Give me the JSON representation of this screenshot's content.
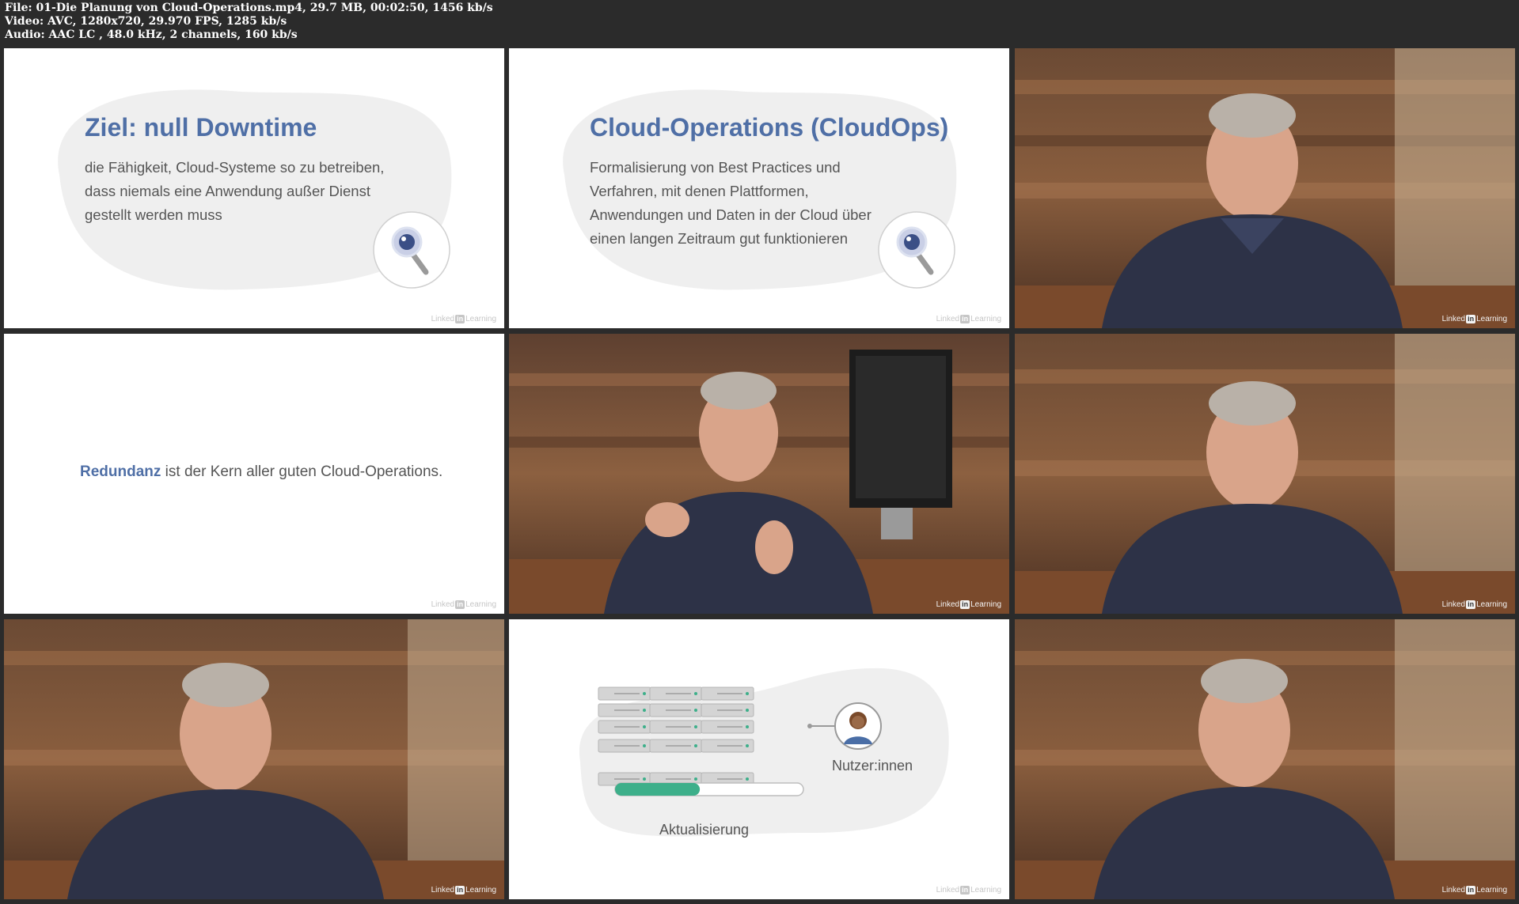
{
  "file_info": {
    "line1": "File: 01-Die Planung von Cloud-Operations.mp4, 29.7 MB, 00:02:50, 1456 kb/s",
    "line2": "Video: AVC, 1280x720, 29.970 FPS, 1285 kb/s",
    "line3": "Audio: AAC LC , 48.0 kHz, 2 channels, 160 kb/s"
  },
  "slides": {
    "goal": {
      "title": "Ziel: null Downtime",
      "body": "die Fähigkeit, Cloud-Systeme so zu betreiben, dass niemals eine Anwendung außer Dienst gestellt werden muss"
    },
    "cloudops": {
      "title": "Cloud-Operations (CloudOps)",
      "body": "Formalisierung von Best Practices und Verfahren, mit denen Plattformen, Anwendungen und Daten in der Cloud über einen langen Zeitraum gut funktionieren"
    },
    "redundancy": {
      "keyword": "Redundanz",
      "rest": " ist der Kern aller guten Cloud-Operations."
    },
    "diagram": {
      "users_label": "Nutzer:innen",
      "update_label": "Aktualisierung",
      "update_progress": 0.45
    }
  },
  "watermark": {
    "brand_prefix": "Linked",
    "brand_badge": "in",
    "brand_suffix": "Learning"
  },
  "colors": {
    "accent": "#4f6fa6",
    "progress": "#3daf8a",
    "blob": "#efefef"
  }
}
